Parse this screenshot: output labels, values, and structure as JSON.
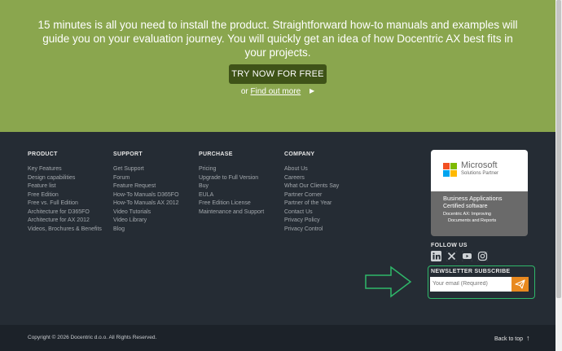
{
  "hero": {
    "text": "15 minutes is all you need to install the product. Straightforward how-to manuals and examples will guide you on your evaluation journey. You will quickly get an idea of how Docentric AX best fits in your projects.",
    "cta_label": "TRY NOW FOR FREE",
    "or_label": "or",
    "find_out_label": "Find out more",
    "arrow_glyph": "▶"
  },
  "footer": {
    "columns": [
      {
        "heading": "PRODUCT",
        "items": [
          "Key Features",
          "Design capabilities",
          "Feature list",
          "Free Edition",
          "Free vs. Full Edition",
          "Architecture for D365FO",
          "Architecture for AX 2012",
          "Videos, Brochures & Benefits"
        ]
      },
      {
        "heading": "SUPPORT",
        "items": [
          "Get Support",
          "Forum",
          "Feature Request",
          "How-To Manuals D365FO",
          "How-To Manuals AX 2012",
          "Video Tutorials",
          "Video Library",
          "Blog"
        ]
      },
      {
        "heading": "PURCHASE",
        "items": [
          "Pricing",
          "Upgrade to Full Version",
          "Buy",
          "EULA",
          "Free Edition License",
          "Maintenance and Support"
        ]
      },
      {
        "heading": "COMPANY",
        "items": [
          "About Us",
          "Careers",
          "What Our Clients Say",
          "Partner Corner",
          "Partner of the Year",
          "Contact Us",
          "Privacy Policy",
          "Privacy Control"
        ]
      }
    ],
    "badge": {
      "brand": "Microsoft",
      "subtitle": "Solutions Partner",
      "line1": "Business Applications",
      "line2": "Certified software",
      "line3": "Docentric AX: Improving",
      "line4": "Documents and Reports"
    },
    "follow": {
      "heading": "FOLLOW US",
      "icons": [
        "linkedin-icon",
        "x-icon",
        "youtube-icon",
        "instagram-icon"
      ]
    },
    "newsletter": {
      "heading": "NEWSLETTER SUBSCRIBE",
      "placeholder": "Your email (Required)",
      "submit_icon": "send-icon"
    }
  },
  "bottom": {
    "copyright": "Copyright © 2026 Docentric d.o.o. All Rights Reserved.",
    "back_to_top": "Back to top",
    "back_to_top_icon": "↑"
  },
  "colors": {
    "hero_bg": "#8aa64e",
    "cta_bg": "#3f5318",
    "footer_bg": "#252c34",
    "bottom_bg": "#1c2229",
    "newsletter_button": "#e8891f",
    "annotation_green": "#2fb86a"
  }
}
